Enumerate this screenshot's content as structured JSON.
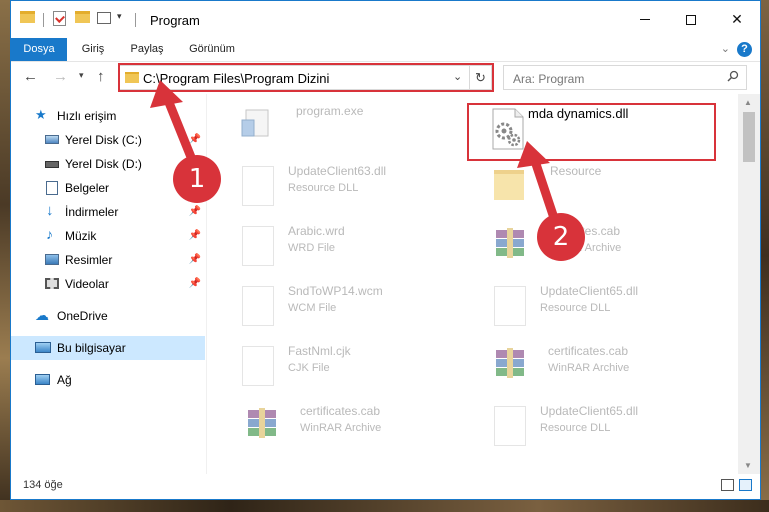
{
  "window": {
    "title": "Program"
  },
  "ribbon": {
    "tabs": [
      {
        "label": "Dosya"
      },
      {
        "label": "Giriş"
      },
      {
        "label": "Paylaş"
      },
      {
        "label": "Görünüm"
      }
    ],
    "help": "?"
  },
  "address_bar": {
    "path": "C:\\Program Files\\Program Dizini"
  },
  "search": {
    "placeholder": "Ara: Program"
  },
  "nav_pane": {
    "items": [
      {
        "label": "Hızlı erişim",
        "icon": "star-icon"
      },
      {
        "label": "Yerel Disk (C:)",
        "icon": "drive-icon",
        "pinned": true
      },
      {
        "label": "Yerel Disk (D:)",
        "icon": "drive-icon"
      },
      {
        "label": "Belgeler",
        "icon": "documents-icon",
        "pinned": true
      },
      {
        "label": "İndirmeler",
        "icon": "download-icon",
        "pinned": true
      },
      {
        "label": "Müzik",
        "icon": "music-icon",
        "pinned": true
      },
      {
        "label": "Resimler",
        "icon": "pictures-icon",
        "pinned": true
      },
      {
        "label": "Videolar",
        "icon": "videos-icon",
        "pinned": true
      },
      {
        "label": "OneDrive",
        "icon": "cloud-icon"
      },
      {
        "label": "Bu bilgisayar",
        "icon": "computer-icon",
        "selected": true
      },
      {
        "label": "Ağ",
        "icon": "network-icon"
      }
    ]
  },
  "files": {
    "main": {
      "name": "mda dynamics.dll",
      "icon": "dll-icon"
    },
    "faded": [
      {
        "name": "program.exe",
        "type": "",
        "icon": "exe-icon"
      },
      {
        "name": "UpdateClient63.dll",
        "type": "Resource DLL",
        "icon": "dll-icon"
      },
      {
        "name": "Resource",
        "type": "",
        "icon": "folder-icon"
      },
      {
        "name": "Arabic.wrd",
        "type": "WRD File",
        "icon": "doc-icon"
      },
      {
        "name": "certificates.cab",
        "type": "WinRAR Archive",
        "icon": "rar-icon"
      },
      {
        "name": "SndToWP14.wcm",
        "type": "WCM File",
        "icon": "doc-icon"
      },
      {
        "name": "UpdateClient65.dll",
        "type": "Resource DLL",
        "icon": "dll-icon"
      },
      {
        "name": "FastNml.cjk",
        "type": "CJK File",
        "icon": "doc-icon"
      },
      {
        "name": "certificates.cab",
        "type": "WinRAR Archive",
        "icon": "rar-icon"
      },
      {
        "name": "certificates.cab",
        "type": "WinRAR Archive",
        "icon": "rar-icon"
      },
      {
        "name": "UpdateClient65.dll",
        "type": "Resource DLL",
        "icon": "dll-icon"
      }
    ]
  },
  "status": {
    "item_count": "134 öğe"
  },
  "annotations": {
    "step1": "1",
    "step2": "2",
    "color": "#d8333a"
  }
}
